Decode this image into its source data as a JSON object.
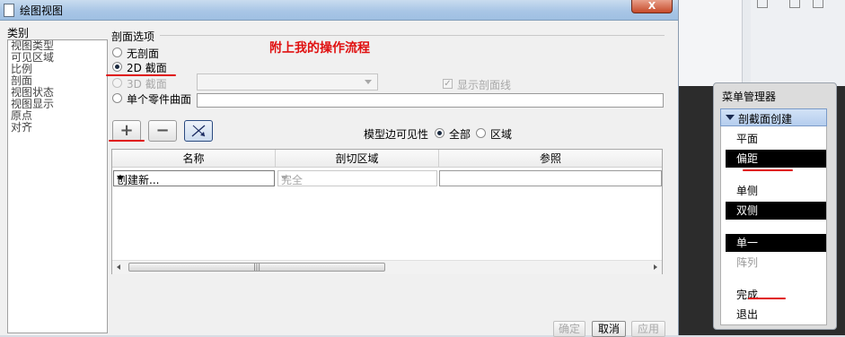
{
  "window": {
    "title": "绘图视图",
    "close_label": "X"
  },
  "categories": {
    "label": "类别",
    "items": [
      "视图类型",
      "可见区域",
      "比例",
      "剖面",
      "视图状态",
      "视图显示",
      "原点",
      "对齐"
    ]
  },
  "section": {
    "legend": "剖面选项",
    "annotation": "附上我的操作流程",
    "options": {
      "none": "无剖面",
      "two_d": "2D 截面",
      "three_d": "3D 截面",
      "single_surface": "单个零件曲面"
    },
    "show_section_lines": "显示剖面线"
  },
  "toolbar": {
    "add": "+",
    "remove": "−"
  },
  "edge_visibility": {
    "label": "模型边可见性",
    "all": "全部",
    "area": "区域"
  },
  "table": {
    "headers": [
      "名称",
      "剖切区域",
      "参照"
    ],
    "row": {
      "name": "创建新...",
      "region": "完全"
    }
  },
  "buttons": {
    "ok": "确定",
    "cancel": "取消",
    "apply": "应用"
  },
  "menu_manager": {
    "title": "菜单管理器",
    "header": "剖截面创建",
    "items": [
      {
        "label": "平面",
        "state": "normal"
      },
      {
        "label": "偏距",
        "state": "selected"
      },
      {
        "label": "单侧",
        "state": "normal"
      },
      {
        "label": "双侧",
        "state": "selected"
      },
      {
        "label": "单一",
        "state": "selected"
      },
      {
        "label": "阵列",
        "state": "disabled"
      },
      {
        "label": "完成",
        "state": "normal"
      },
      {
        "label": "退出",
        "state": "normal"
      }
    ]
  },
  "colors": {
    "annotation": "#e01010",
    "selected_menu_bg": "#000000"
  }
}
